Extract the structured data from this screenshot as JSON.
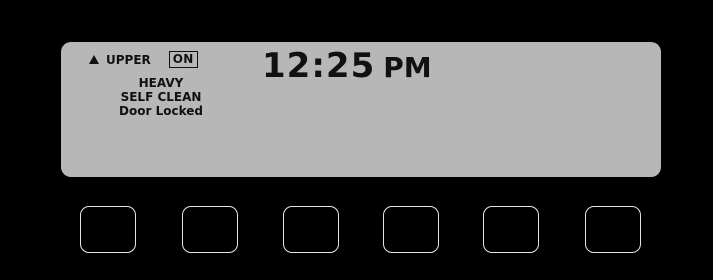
{
  "display": {
    "oven_label": "UPPER",
    "on_badge": "ON",
    "time": "12:25",
    "ampm": "PM",
    "lines": [
      "HEAVY",
      "SELF CLEAN",
      "Door Locked"
    ]
  },
  "icons": {
    "oven_indicator": "arrow-up-icon"
  },
  "colors": {
    "panel": "#000000",
    "lcd": "#b7b7b7",
    "text": "#111111",
    "key_border": "#e6e6e6"
  },
  "keys": [
    "",
    "",
    "",
    "",
    "",
    ""
  ]
}
